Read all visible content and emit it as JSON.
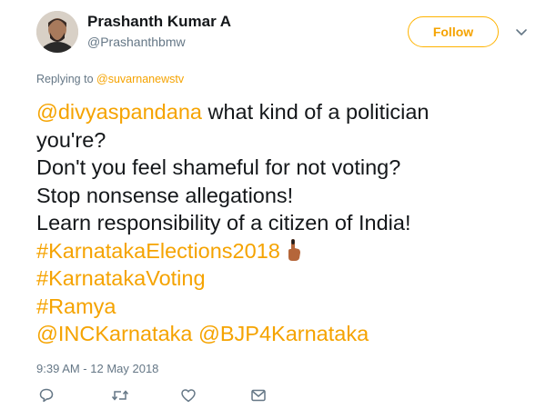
{
  "author": {
    "name": "Prashanth Kumar A",
    "handle": "@Prashanthbmw"
  },
  "follow_button": {
    "label": "Follow"
  },
  "reply_context": {
    "prefix": "Replying to ",
    "target": "@suvarnanewstv"
  },
  "tweet": {
    "mention_1": "@divyaspandana",
    "line_1_rest": " what kind of a politician",
    "line_2": "you're?",
    "line_3": "Don't you feel shameful for not voting?",
    "line_4": "Stop nonsense allegations!",
    "line_5": "Learn responsibility of a citizen of India!",
    "hashtag_1": "#KarnatakaElections2018",
    "hashtag_2": "#KarnatakaVoting",
    "hashtag_3": "#Ramya",
    "mention_2": "@INCKarnataka",
    "mention_3": "@BJP4Karnataka"
  },
  "timestamp": "9:39 AM - 12 May 2018",
  "icons": {
    "caret": "chevron-down-icon",
    "reply": "reply-icon",
    "retweet": "retweet-icon",
    "like": "heart-icon",
    "message": "envelope-icon",
    "emoji": "inked-finger-emoji"
  },
  "colors": {
    "accent": "#f5a300",
    "text": "#14171a",
    "muted": "#657786"
  }
}
